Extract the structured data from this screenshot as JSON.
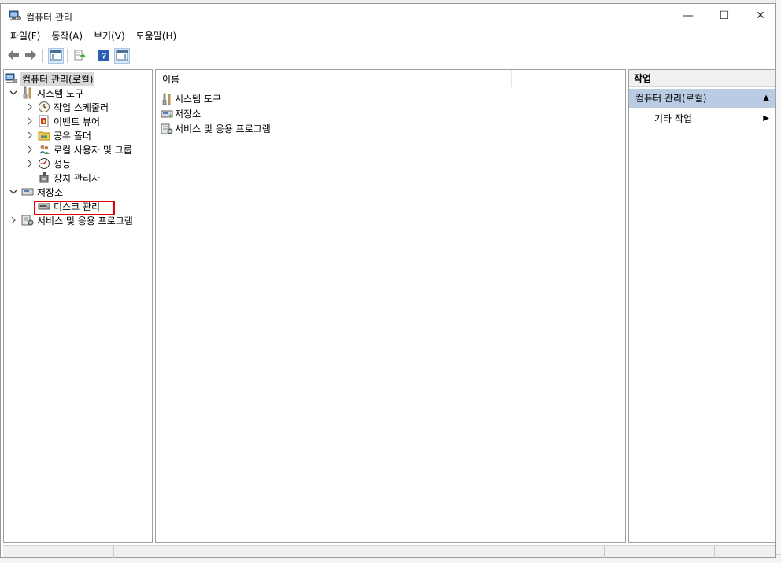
{
  "window": {
    "title": "컴퓨터 관리",
    "controls": {
      "minimize": "—",
      "maximize": "☐",
      "close": "✕"
    }
  },
  "menu": [
    "파일(F)",
    "동작(A)",
    "보기(V)",
    "도움말(H)"
  ],
  "toolbar": [
    "back-arrow-icon",
    "forward-arrow-icon",
    "show-hide-tree-icon",
    "export-list-icon",
    "help-icon",
    "show-hide-action-pane-icon"
  ],
  "tree": {
    "root": "컴퓨터 관리(로컬)",
    "system_tools": "시스템 도구",
    "task_scheduler": "작업 스케줄러",
    "event_viewer": "이벤트 뷰어",
    "shared_folders": "공유 폴더",
    "local_users_groups": "로컬 사용자 및 그룹",
    "performance": "성능",
    "device_manager": "장치 관리자",
    "storage": "저장소",
    "disk_management": "디스크 관리",
    "services_apps": "서비스 및 응용 프로그램"
  },
  "center": {
    "column_header": "이름",
    "items": [
      "시스템 도구",
      "저장소",
      "서비스 및 응용 프로그램"
    ]
  },
  "actions": {
    "header": "작업",
    "section": "컴퓨터 관리(로컬)",
    "item": "기타 작업"
  },
  "colors": {
    "selection": "#d9d9d9",
    "action_section": "#b9cce4",
    "highlight_box": "#e00000"
  }
}
